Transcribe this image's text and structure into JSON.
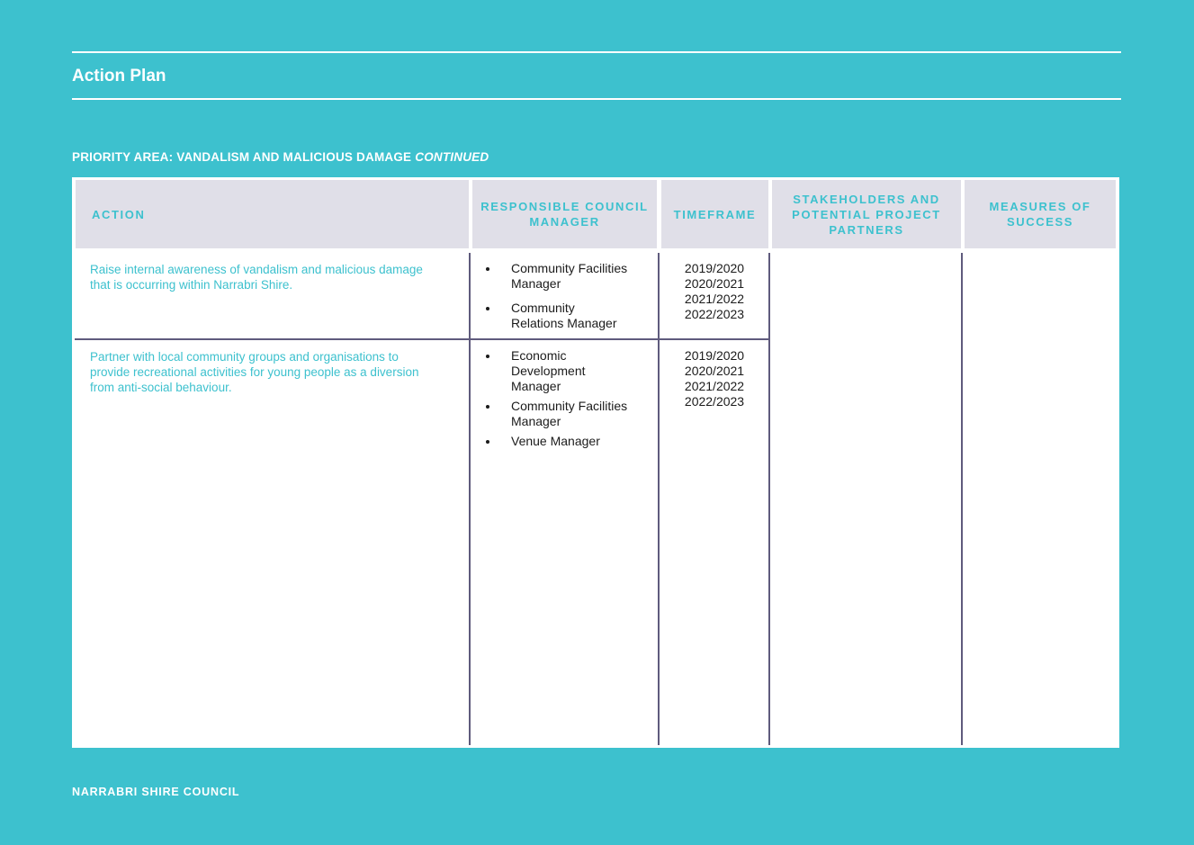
{
  "header": {
    "title": "Action Plan"
  },
  "priority": {
    "label": "PRIORITY AREA: VANDALISM AND MALICIOUS DAMAGE",
    "continued": "CONTINUED"
  },
  "table": {
    "columns": [
      "ACTION",
      "RESPONSIBLE COUNCIL MANAGER",
      "TIMEFRAME",
      "STAKEHOLDERS AND POTENTIAL PROJECT PARTNERS",
      "MEASURES OF SUCCESS"
    ],
    "rows": [
      {
        "action": "Raise internal awareness of vandalism and malicious damage that is occurring within Narrabri Shire.",
        "managers": [
          "Community Facilities Manager",
          "Community Relations Manager"
        ],
        "timeframe": [
          "2019/2020",
          "2020/2021",
          "2021/2022",
          "2022/2023"
        ]
      },
      {
        "action": "Partner with local community groups and organisations to provide recreational activities for young people as a diversion from anti-social behaviour.",
        "managers": [
          "Economic Development Manager",
          "Community Facilities Manager",
          "Venue Manager"
        ],
        "timeframe": [
          "2019/2020",
          "2020/2021",
          "2021/2022",
          "2022/2023"
        ]
      }
    ]
  },
  "footer": {
    "org": "NARRABRI SHIRE COUNCIL"
  }
}
